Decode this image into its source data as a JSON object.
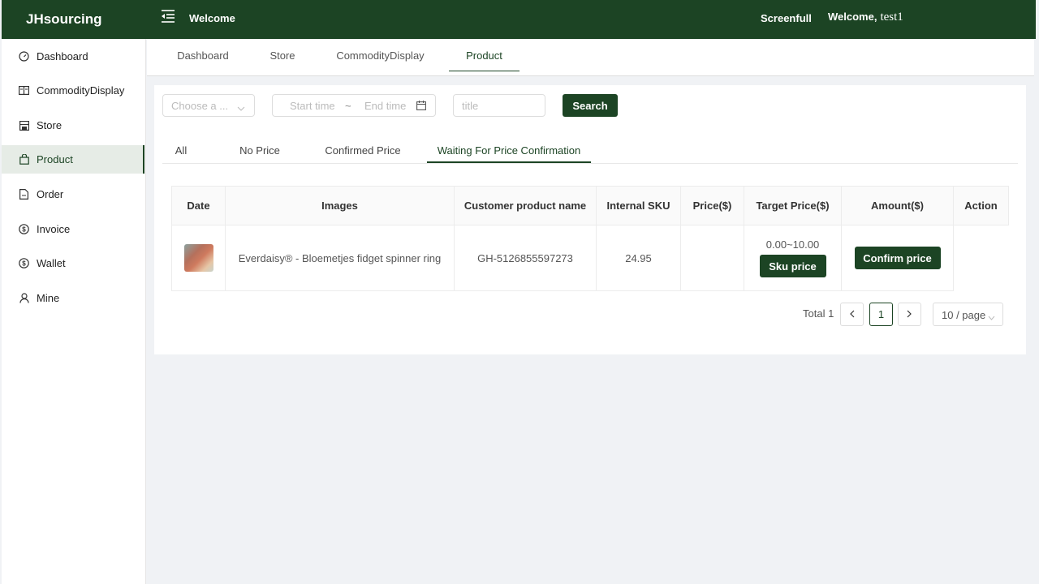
{
  "header": {
    "logo": "JHsourcing",
    "title": "Welcome",
    "screenfull": "Screenfull",
    "greeting": "Welcome,",
    "username": "test1",
    "brand_color": "#1c4424"
  },
  "sidebar": {
    "items": [
      {
        "label": "Dashboard",
        "icon": "dashboard-icon"
      },
      {
        "label": "CommodityDisplay",
        "icon": "book-icon"
      },
      {
        "label": "Store",
        "icon": "store-icon"
      },
      {
        "label": "Product",
        "icon": "bag-icon",
        "active": true
      },
      {
        "label": "Order",
        "icon": "document-icon"
      },
      {
        "label": "Invoice",
        "icon": "dollar-circle-icon"
      },
      {
        "label": "Wallet",
        "icon": "dollar-circle-icon"
      },
      {
        "label": "Mine",
        "icon": "user-icon"
      }
    ]
  },
  "tabs": {
    "items": [
      {
        "label": "Dashboard"
      },
      {
        "label": "Store"
      },
      {
        "label": "CommodityDisplay"
      },
      {
        "label": "Product",
        "active": true
      }
    ]
  },
  "filters": {
    "select_placeholder": "Choose a ...",
    "start_placeholder": "Start time",
    "separator": "~",
    "end_placeholder": "End time",
    "title_placeholder": "title",
    "title_value": "",
    "search_label": "Search"
  },
  "status_tabs": {
    "items": [
      {
        "label": "All"
      },
      {
        "label": "No Price"
      },
      {
        "label": "Confirmed Price"
      },
      {
        "label": "Waiting For Price Confirmation",
        "active": true
      }
    ]
  },
  "table": {
    "columns": [
      "Date",
      "Images",
      "Customer product name",
      "Internal SKU",
      "Price($)",
      "Target Price($)",
      "Amount($)",
      "Action"
    ],
    "rows": [
      {
        "image_alt": "hand wearing ring",
        "product_name": "Everdaisy® - Bloemetjes fidget spinner ring",
        "customer_product_name": "GH-5126855597273",
        "internal_sku": "24.95",
        "price": "",
        "target_price": "0.00~10.00",
        "sku_price_button": "Sku price",
        "confirm_button": "Confirm price"
      }
    ]
  },
  "pagination": {
    "total_label": "Total 1",
    "current_page": "1",
    "page_size": "10 / page"
  }
}
